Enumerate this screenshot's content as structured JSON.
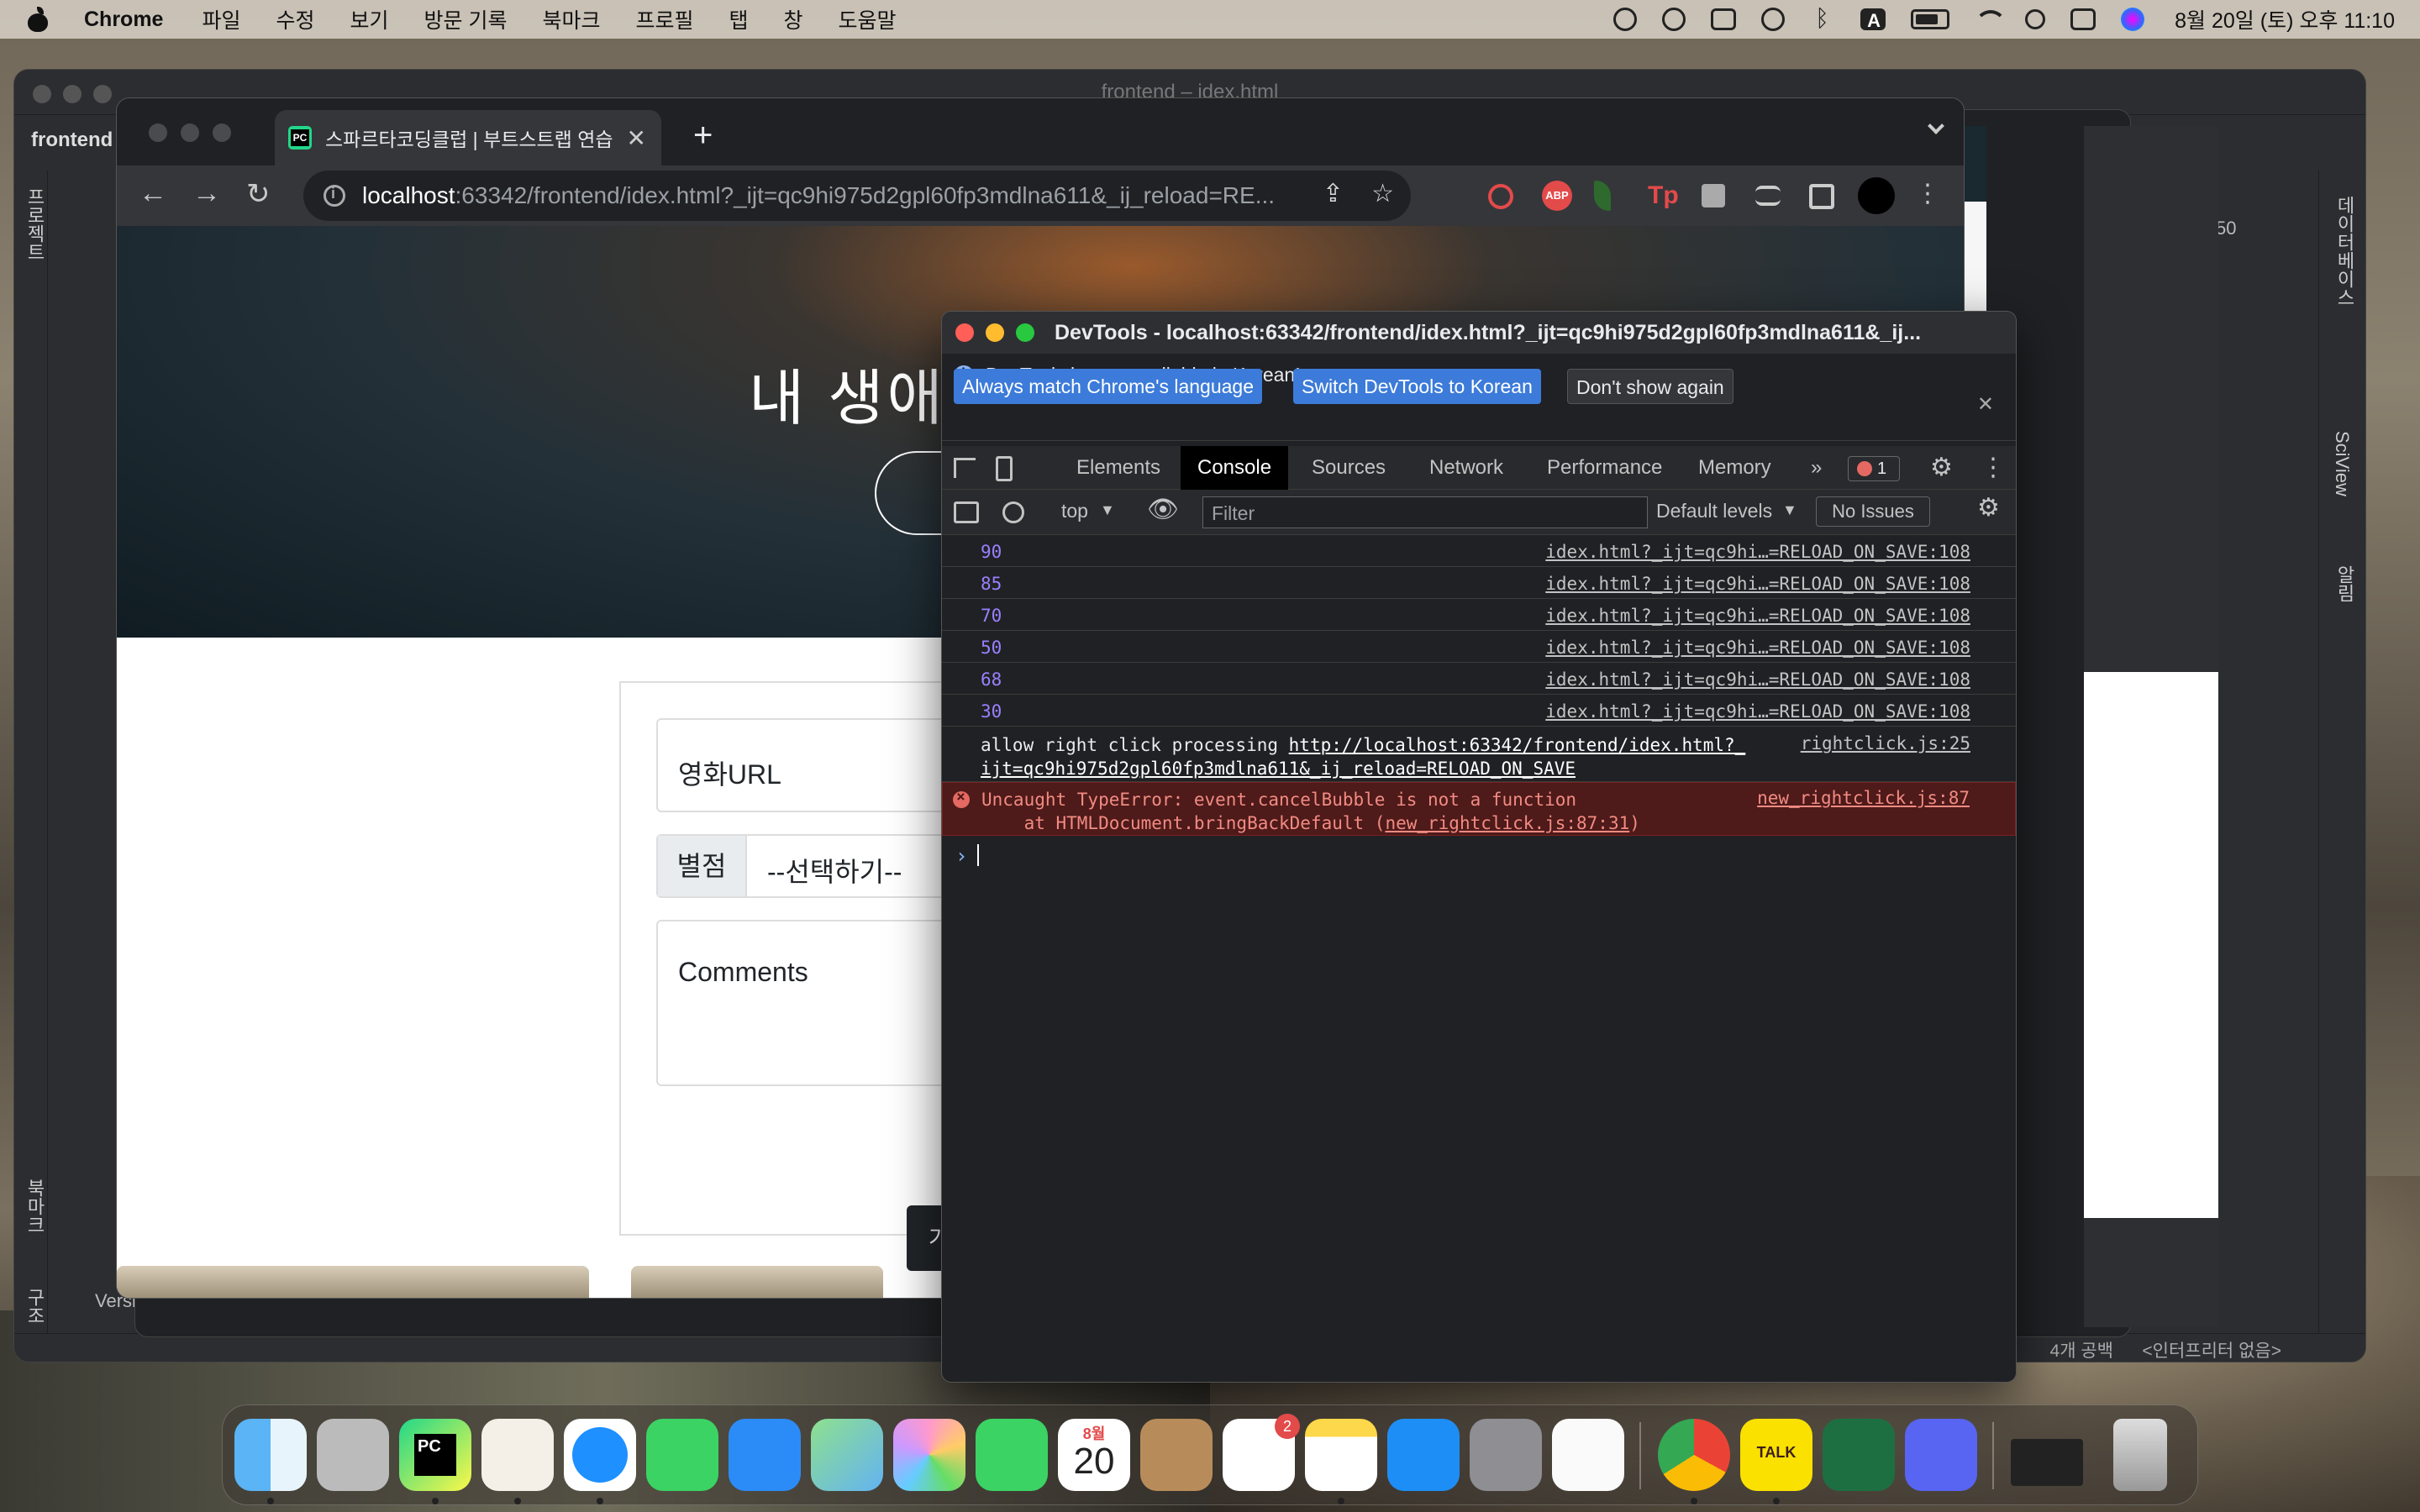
{
  "menubar": {
    "app": "Chrome",
    "items": [
      "파일",
      "수정",
      "보기",
      "방문 기록",
      "북마크",
      "프로필",
      "탭",
      "창",
      "도움말"
    ],
    "clock": "8월 20일 (토) 오후 11:10",
    "status_icons": [
      "creative-cloud-icon",
      "sync-icon",
      "screen-mirroring-icon",
      "play-icon",
      "bluetooth-icon",
      "input-source-icon",
      "battery-icon",
      "wifi-icon",
      "spotlight-icon",
      "control-center-icon",
      "siri-icon"
    ]
  },
  "pycharm": {
    "title": "frontend – idex.html",
    "project_tab": "frontend",
    "left_tool_project": "프로젝트",
    "left_tool_bookmarks": "북마크",
    "left_tool_structure": "구조",
    "right_tool_db": "데이터베이스",
    "right_tool_sciview": "SciView",
    "right_tool_notifications": "알림",
    "version_control": "Version Control",
    "status_spaces": "4개 공백",
    "status_interpreter": "<인터프리터 없음>",
    "editor_readout": "50"
  },
  "chrome": {
    "tab_title": "스파르타코딩클럽 | 부트스트랩 연습",
    "new_tab": "+",
    "url_host": "localhost",
    "url_rest": ":63342/frontend/idex.html?_ijt=qc9hi975d2gpl60fp3mdlna611&_ij_reload=RE...",
    "extensions": [
      "block-icon",
      "abp-icon",
      "leaf-icon",
      "tp-icon",
      "puzzle-icon",
      "media-icon",
      "sidepanel-icon",
      "profile-avatar"
    ]
  },
  "page": {
    "hero_title": "내 생애",
    "card": {
      "url_placeholder": "영화URL",
      "star_label": "별점",
      "star_select": "--선택하기--",
      "comments_placeholder": "Comments",
      "save_button": "기"
    }
  },
  "devtools": {
    "title": "DevTools - localhost:63342/frontend/idex.html?_ijt=qc9hi975d2gpl60fp3mdlna611&_ij...",
    "banner_message": "DevTools is now available in Korean!",
    "banner_buttons": [
      "Always match Chrome's language",
      "Switch DevTools to Korean",
      "Don't show again"
    ],
    "tabs": [
      "Elements",
      "Console",
      "Sources",
      "Network",
      "Performance",
      "Memory"
    ],
    "active_tab": "Console",
    "more_tabs": "»",
    "error_count": "1",
    "context": "top",
    "filter_placeholder": "Filter",
    "levels": "Default levels",
    "issues": "No Issues",
    "log": [
      {
        "value": "90",
        "source": "idex.html?_ijt=qc9hi…=RELOAD_ON_SAVE:108"
      },
      {
        "value": "85",
        "source": "idex.html?_ijt=qc9hi…=RELOAD_ON_SAVE:108"
      },
      {
        "value": "70",
        "source": "idex.html?_ijt=qc9hi…=RELOAD_ON_SAVE:108"
      },
      {
        "value": "50",
        "source": "idex.html?_ijt=qc9hi…=RELOAD_ON_SAVE:108"
      },
      {
        "value": "68",
        "source": "idex.html?_ijt=qc9hi…=RELOAD_ON_SAVE:108"
      },
      {
        "value": "30",
        "source": "idex.html?_ijt=qc9hi…=RELOAD_ON_SAVE:108"
      }
    ],
    "message": {
      "text": "allow right click processing ",
      "link_1": "http://localhost:63342/frontend/idex.html?_",
      "link_2": "ijt=qc9hi975d2gpl60fp3mdlna611&_ij_reload=RELOAD_ON_SAVE",
      "source": "rightclick.js:25"
    },
    "error": {
      "line1": "Uncaught TypeError: event.cancelBubble is not a function",
      "line2_prefix": "    at HTMLDocument.bringBackDefault (",
      "line2_link": "new_rightclick.js:87:31",
      "line2_suffix": ")",
      "source": "new_rightclick.js:87"
    },
    "prompt": "›"
  },
  "dock": {
    "apps": [
      "finder",
      "launchpad",
      "pycharm",
      "cyberduck",
      "safari",
      "messages",
      "mail",
      "maps",
      "photos",
      "facetime",
      "calendar",
      "contacts",
      "reminders",
      "notes",
      "app-store",
      "system-preferences",
      "textedit",
      "chrome",
      "kakaotalk",
      "excel",
      "discord",
      "minimized-window",
      "trash"
    ],
    "calendar_month": "8월",
    "calendar_day": "20",
    "reminders_badge": "2",
    "kakaotalk_label": "TALK"
  }
}
